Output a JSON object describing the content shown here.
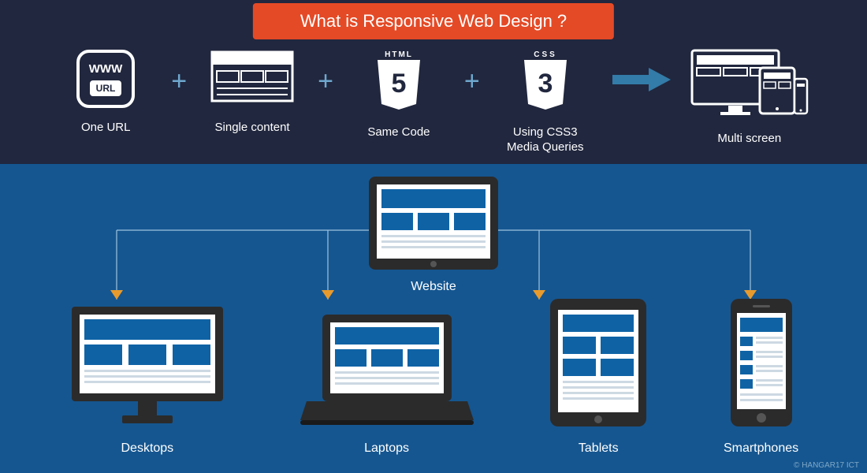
{
  "title": "What is Responsive Web Design ?",
  "equation": {
    "items": [
      {
        "label": "One URL"
      },
      {
        "label": "Single content"
      },
      {
        "label": "Same Code"
      },
      {
        "label": "Using CSS3\nMedia Queries"
      }
    ],
    "result": {
      "label": "Multi screen"
    }
  },
  "center": {
    "label": "Website"
  },
  "devices": [
    {
      "label": "Desktops"
    },
    {
      "label": "Laptops"
    },
    {
      "label": "Tablets"
    },
    {
      "label": "Smartphones"
    }
  ],
  "copyright": "© HANGAR17 ICT",
  "icons": {
    "www_top": "WWW",
    "www_url": "URL",
    "html5_top": "HTML",
    "css3_top": "CSS"
  },
  "colors": {
    "accent": "#e44a26",
    "dark": "#21273e",
    "blue": "#155690",
    "panel": "#0f63a5",
    "arrow": "#337ba8",
    "tri": "#e89b2c"
  }
}
